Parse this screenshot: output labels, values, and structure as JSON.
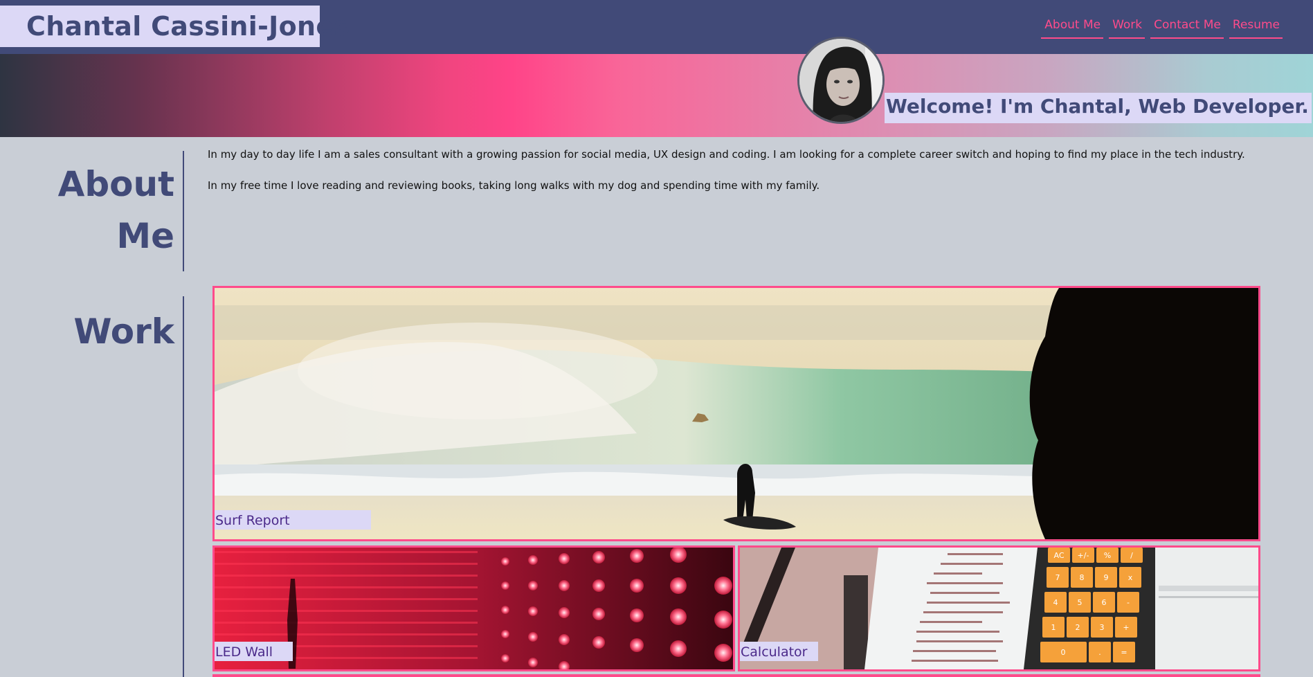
{
  "header": {
    "name": "Chantal Cassini-Jones",
    "nav": [
      {
        "label": "About Me"
      },
      {
        "label": "Work"
      },
      {
        "label": "Contact Me"
      },
      {
        "label": "Resume"
      }
    ]
  },
  "hero": {
    "welcome": "Welcome! I'm Chantal, Web Developer."
  },
  "about": {
    "title_line1": "About",
    "title_line2": "Me",
    "paragraphs": [
      "In my day to day life I am a sales consultant with a growing passion for social media, UX design and coding. I am looking for a complete career switch and hoping to find my place in the tech industry.",
      "In my free time I love reading and reviewing books, taking long walks with my dog and spending time with my family."
    ]
  },
  "work": {
    "title": "Work",
    "projects": [
      {
        "label": "Surf Report"
      },
      {
        "label": "LED Wall"
      },
      {
        "label": "Calculator"
      }
    ],
    "calc_keys": [
      "AC",
      "+/-",
      "%",
      "/",
      "7",
      "8",
      "9",
      "x",
      "4",
      "5",
      "6",
      "-",
      "1",
      "2",
      "3",
      "+",
      "0",
      ".",
      "="
    ]
  },
  "colors": {
    "navy": "#414a78",
    "accent_pink": "#ff4b8b",
    "lavender": "#dcd8f6",
    "background": "#c9ced6"
  }
}
